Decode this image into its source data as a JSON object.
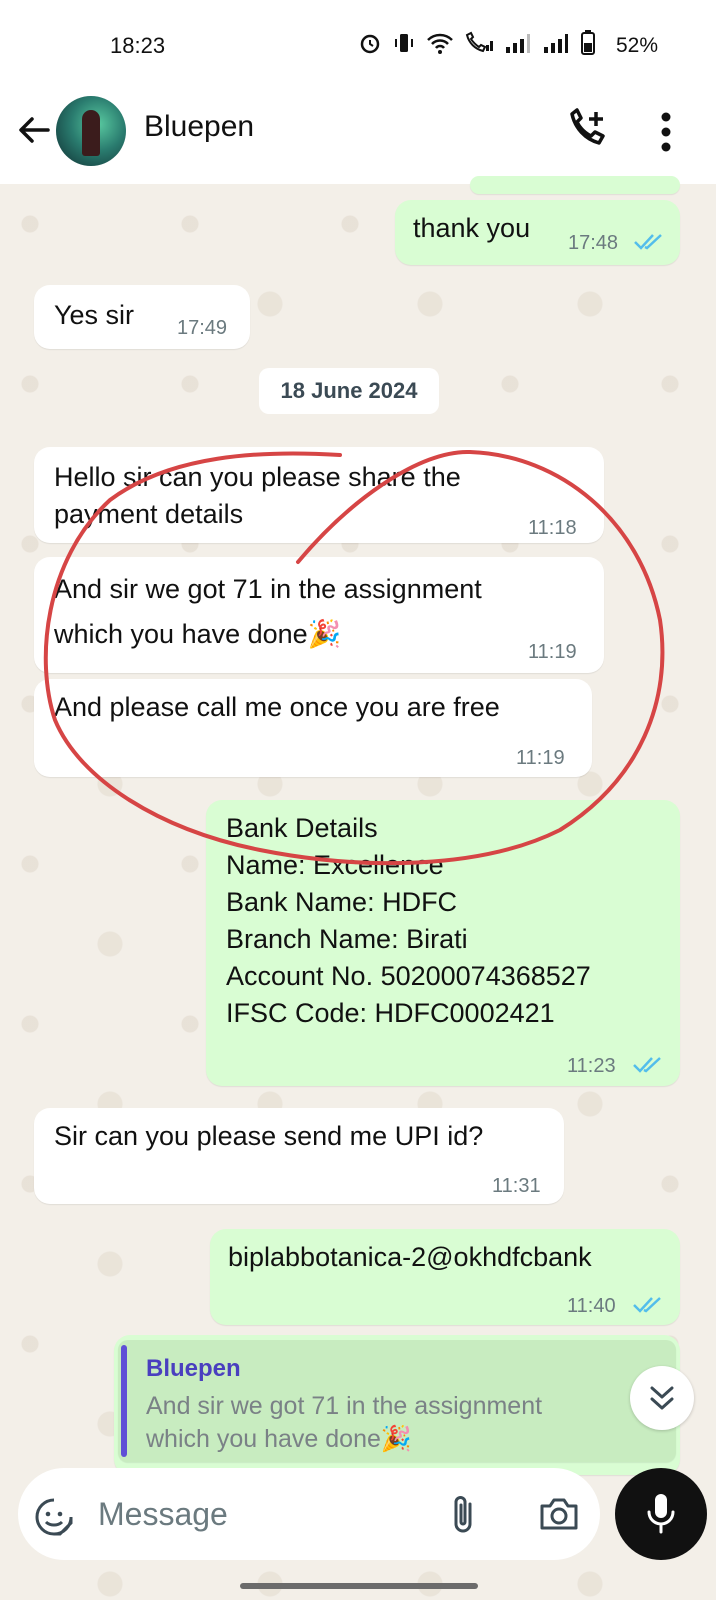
{
  "status_bar": {
    "time": "18:23",
    "battery": "52%"
  },
  "header": {
    "contact_name": "Bluepen"
  },
  "messages": [
    {
      "text": "thank you",
      "time": "17:48"
    },
    {
      "text": "Yes sir",
      "time": "17:49"
    },
    {
      "text": "Hello sir can you please share the\npayment details",
      "time": "11:18"
    },
    {
      "text": "And sir we got 71 in the assignment\nwhich you have done🎉",
      "time": "11:19"
    },
    {
      "text": "And please call me once you are free",
      "time": "11:19"
    },
    {
      "text": "Bank Details\nName: Excellence\nBank Name: HDFC\nBranch Name: Birati\nAccount No. 50200074368527\nIFSC Code: HDFC0002421",
      "time": "11:23"
    },
    {
      "text": "Sir can you please send me UPI id?",
      "time": "11:31"
    },
    {
      "text": "biplabbotanica-2@okhdfcbank",
      "time": "11:40"
    }
  ],
  "date_chip": "18 June 2024",
  "reply": {
    "quoted_name": "Bluepen",
    "quoted_text": "And sir we got 71 in the assignment\nwhich you have done🎉"
  },
  "composer": {
    "placeholder": "Message"
  },
  "colors": {
    "outgoing_bubble": "#d9fdd3",
    "incoming_bubble": "#ffffff",
    "read_ticks": "#53bdeb",
    "annotation": "#d64545"
  }
}
